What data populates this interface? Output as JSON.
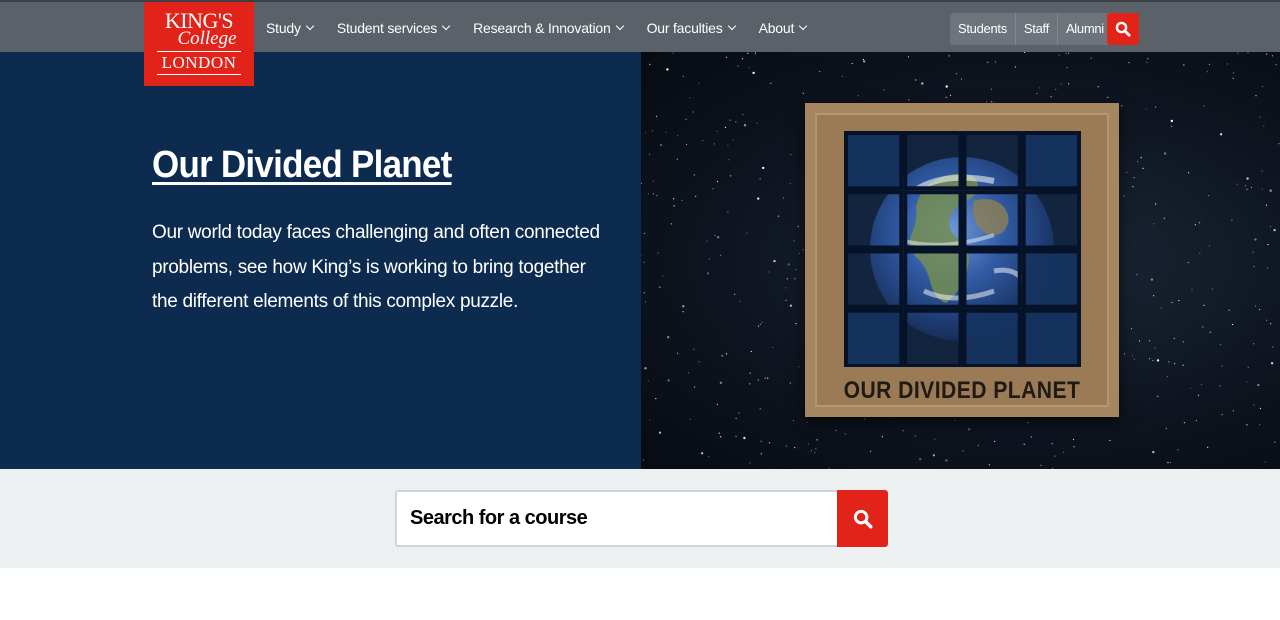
{
  "logo": {
    "line1": "KING'S",
    "line2": "College",
    "line3": "LONDON"
  },
  "nav": {
    "items": [
      {
        "label": "Study"
      },
      {
        "label": "Student services"
      },
      {
        "label": "Research & Innovation"
      },
      {
        "label": "Our faculties"
      },
      {
        "label": "About"
      }
    ]
  },
  "audience": {
    "students": "Students",
    "staff": "Staff",
    "alumni": "Alumni"
  },
  "hero": {
    "title": "Our Divided Planet",
    "description": "Our world today faces challenging and often connected problems, see how King’s is working to bring together the different elements of this complex puzzle.",
    "image_caption": "OUR DIVIDED PLANET"
  },
  "course_search": {
    "placeholder": "Search for a course"
  },
  "colors": {
    "brand_red": "#e2231a",
    "hero_navy": "#0c2b4f",
    "topbar_grey": "#5a6168"
  },
  "icons": {
    "search": "search-icon",
    "chevron": "chevron-down-icon"
  }
}
